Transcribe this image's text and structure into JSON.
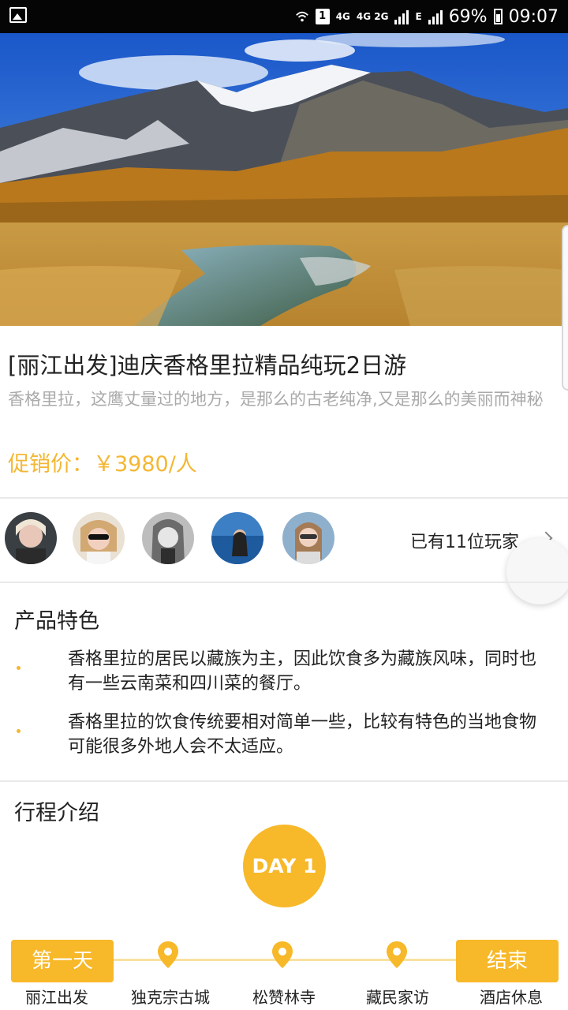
{
  "status_bar": {
    "sim_slot": "1",
    "network_a": "4G",
    "network_b": "4G 2G",
    "network_c": "E",
    "battery_percent": "69%",
    "time": "09:07"
  },
  "product": {
    "title": "[丽江出发]迪庆香格里拉精品纯玩2日游",
    "subtitle": "香格里拉，这鹰丈量过的地方，是那么的古老纯净,又是那么的美丽而神秘",
    "price": "促销价：￥3980/人"
  },
  "players": {
    "count_text": "已有11位玩家"
  },
  "features": {
    "title": "产品特色",
    "items": [
      "香格里拉的居民以藏族为主，因此饮食多为藏族风味，同时也有一些云南菜和四川菜的餐厅。",
      "香格里拉的饮食传统要相对简单一些，比较有特色的当地食物可能很多外地人会不太适应。"
    ]
  },
  "itinerary": {
    "title": "行程介绍",
    "day_label": "DAY 1",
    "start_label": "第一天",
    "end_label": "结束",
    "stops": [
      "丽江出发",
      "独克宗古城",
      "松赞林寺",
      "藏民家访",
      "酒店休息"
    ]
  },
  "colors": {
    "accent": "#f7b829",
    "price": "#f4b733",
    "muted_text": "#aaaaaa"
  }
}
